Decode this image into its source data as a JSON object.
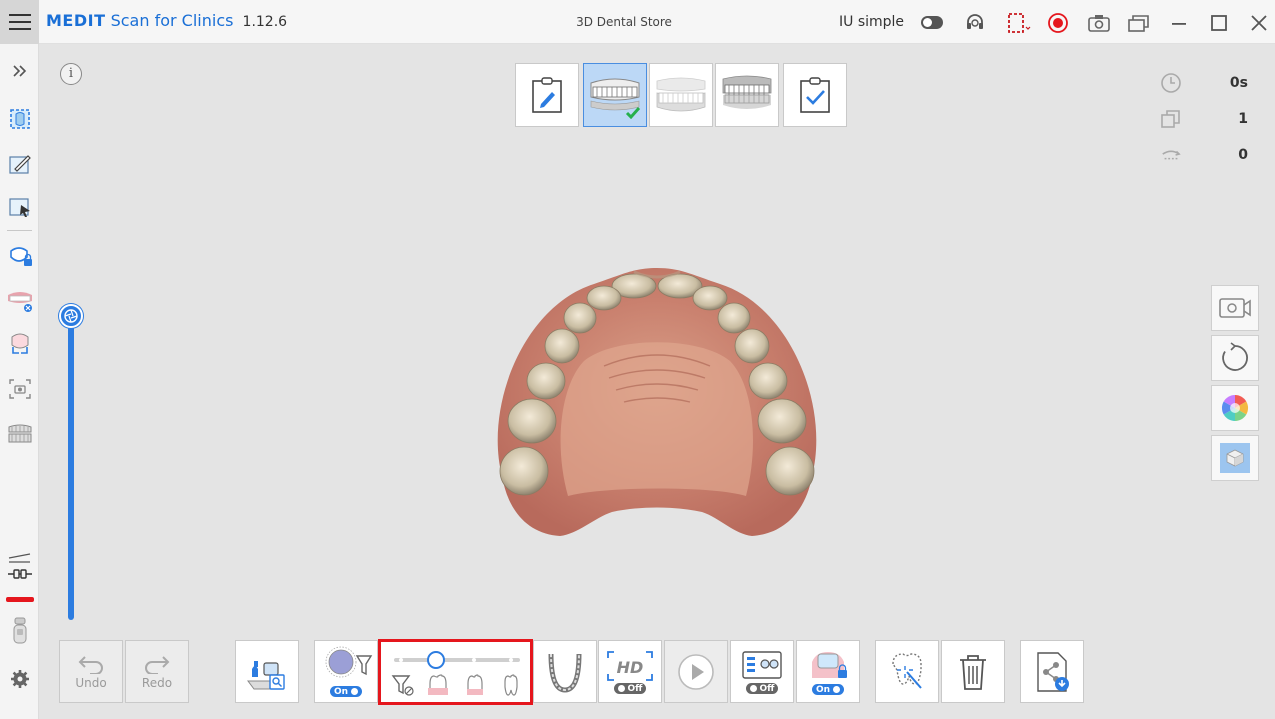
{
  "app": {
    "brand": "MEDIT",
    "name": "Scan for Clinics",
    "version": "1.12.6",
    "store": "3D Dental Store"
  },
  "titlebar": {
    "mode_label": "IU simple",
    "mode_toggle_on": false,
    "icons": [
      "headset-icon",
      "record-area-icon",
      "record-icon",
      "screenshot-icon",
      "window-mode-icon",
      "minimize-icon",
      "maximize-icon",
      "close-icon"
    ]
  },
  "sidebar": {
    "items": [
      "scan-area-icon",
      "edit-data-icon",
      "select-region-icon",
      "lock-area-icon",
      "remove-teeth-icon",
      "scan-box-icon",
      "capture-area-icon",
      "model-crop-icon",
      "tip-calibration-icon",
      "device-icon",
      "settings-icon"
    ]
  },
  "stages": [
    {
      "name": "notes",
      "active": false
    },
    {
      "name": "maxilla",
      "active": true,
      "done": true
    },
    {
      "name": "mandible",
      "active": false
    },
    {
      "name": "occlusion",
      "active": false
    },
    {
      "name": "review",
      "active": false
    }
  ],
  "stats": {
    "time": "0s",
    "count": "1",
    "rotations": "0"
  },
  "vertical_slider": {
    "level": 1.0
  },
  "toolbar": {
    "undo_label": "Undo",
    "redo_label": "Redo",
    "smart_filter_state": "On",
    "filter_level": 0.33,
    "hd_label": "HD",
    "hd_state": "Off",
    "ai_state": "Off",
    "soft_tissue_state": "On"
  },
  "colors": {
    "accent": "#2c7ce0",
    "highlight": "#e5161d",
    "record": "#e5161d",
    "active_stage": "#bcd8f6"
  }
}
